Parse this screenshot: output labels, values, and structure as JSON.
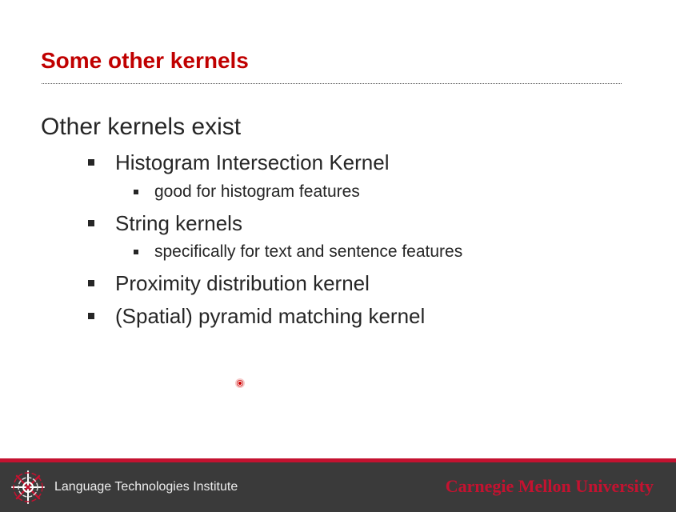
{
  "slide": {
    "title": "Some other kernels",
    "heading": "Other kernels exist",
    "bullets": [
      {
        "label": "Histogram Intersection Kernel",
        "sub": "good for histogram features"
      },
      {
        "label": "String kernels",
        "sub": "specifically for text and sentence features"
      },
      {
        "label": "Proximity distribution kernel"
      },
      {
        "label": "(Spatial) pyramid matching kernel"
      }
    ]
  },
  "footer": {
    "institute_name": "Language Technologies Institute",
    "university_name": "Carnegie Mellon University",
    "logo_icon": "lti-spiral-logo-icon"
  },
  "colors": {
    "title_red": "#c00000",
    "body_text": "#262626",
    "footer_bg": "#3a3a3a",
    "accent_red": "#c41230"
  }
}
